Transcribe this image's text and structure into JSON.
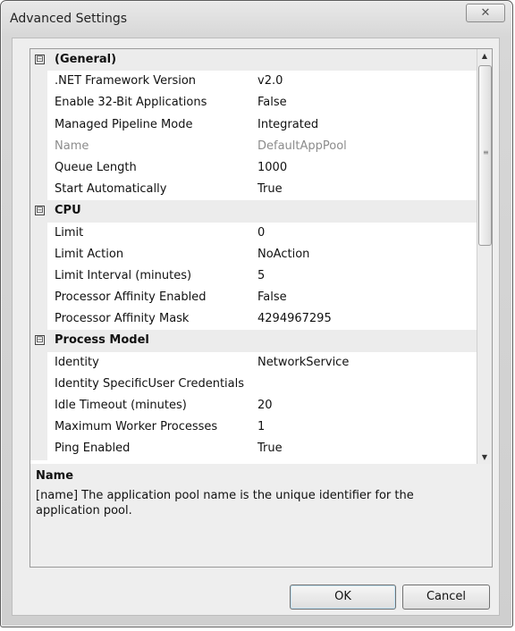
{
  "window": {
    "title": "Advanced Settings",
    "close_glyph": "✕"
  },
  "grid": {
    "rows": [
      {
        "type": "category",
        "toggle": "⊟",
        "label": "(General)"
      },
      {
        "type": "property",
        "name": ".NET Framework Version",
        "value": "v2.0"
      },
      {
        "type": "property",
        "name": "Enable 32-Bit Applications",
        "value": "False"
      },
      {
        "type": "property",
        "name": "Managed Pipeline Mode",
        "value": "Integrated"
      },
      {
        "type": "property",
        "name": "Name",
        "value": "DefaultAppPool",
        "readonly": true
      },
      {
        "type": "property",
        "name": "Queue Length",
        "value": "1000"
      },
      {
        "type": "property",
        "name": "Start Automatically",
        "value": "True"
      },
      {
        "type": "category",
        "toggle": "⊟",
        "label": "CPU"
      },
      {
        "type": "property",
        "name": "Limit",
        "value": "0"
      },
      {
        "type": "property",
        "name": "Limit Action",
        "value": "NoAction"
      },
      {
        "type": "property",
        "name": "Limit Interval (minutes)",
        "value": "5"
      },
      {
        "type": "property",
        "name": "Processor Affinity Enabled",
        "value": "False"
      },
      {
        "type": "property",
        "name": "Processor Affinity Mask",
        "value": "4294967295"
      },
      {
        "type": "category",
        "toggle": "⊟",
        "label": "Process Model"
      },
      {
        "type": "property",
        "name": "Identity",
        "value": "NetworkService"
      },
      {
        "type": "property",
        "name": "Identity SpecificUser Credentials",
        "value": ""
      },
      {
        "type": "property",
        "name": "Idle Timeout (minutes)",
        "value": "20"
      },
      {
        "type": "property",
        "name": "Maximum Worker Processes",
        "value": "1"
      },
      {
        "type": "property",
        "name": "Ping Enabled",
        "value": "True"
      }
    ],
    "scrollbar": {
      "up_glyph": "▲",
      "down_glyph": "▼",
      "grip_glyph": "≡"
    }
  },
  "description": {
    "title": "Name",
    "text": "[name] The application pool name is the unique identifier for the application pool."
  },
  "buttons": {
    "ok": "OK",
    "cancel": "Cancel"
  },
  "icons": [
    "close-icon",
    "collapse-icon",
    "scroll-up-icon",
    "scroll-down-icon",
    "resize-grip-icon"
  ]
}
